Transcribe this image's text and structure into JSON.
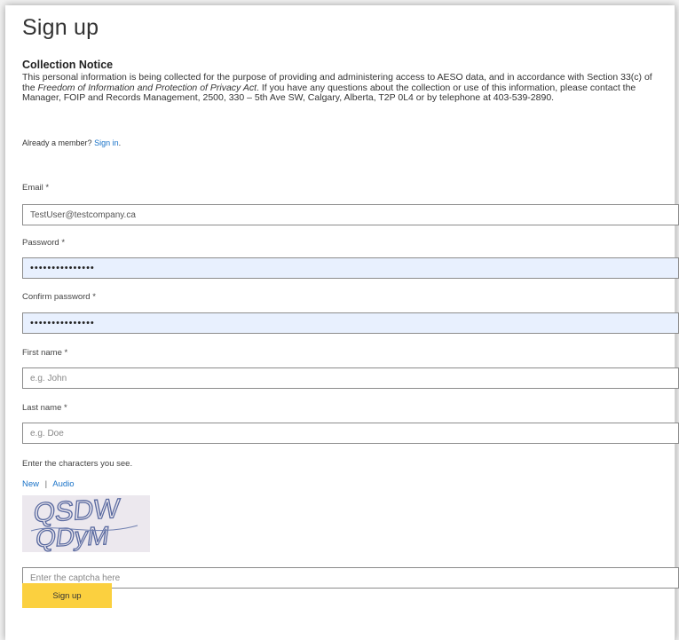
{
  "page": {
    "title": "Sign up"
  },
  "notice": {
    "title": "Collection Notice",
    "text_before_italic": "This personal information is being collected for the purpose of providing and administering access to AESO data, and in accordance with Section 33(c) of the ",
    "italic_text": "Freedom of Information and Protection of Privacy Act",
    "text_after_italic": ". If you have any questions about the collection or use of this information, please contact the Manager, FOIP and Records Management, 2500, 330 – 5th Ave SW, Calgary, Alberta, T2P 0L4 or by telephone at 403-539-2890."
  },
  "member": {
    "prompt": "Already a member?",
    "signin_label": "Sign in",
    "suffix": "."
  },
  "form": {
    "email": {
      "label": "Email *",
      "value": "TestUser@testcompany.ca"
    },
    "password": {
      "label": "Password *",
      "value": "•••••••••••••••"
    },
    "confirm_password": {
      "label": "Confirm password *",
      "value": "•••••••••••••••"
    },
    "first_name": {
      "label": "First name *",
      "placeholder": "e.g. John"
    },
    "last_name": {
      "label": "Last name *",
      "placeholder": "e.g. Doe"
    }
  },
  "captcha": {
    "instruction": "Enter the characters you see.",
    "new_label": "New",
    "separator": "|",
    "audio_label": "Audio",
    "image_text_line1": "QSDW",
    "image_text_line2": "QDyM",
    "input_placeholder": "Enter the captcha here"
  },
  "submit": {
    "label": "Sign up",
    "color": "#fbd03f"
  },
  "colors": {
    "link": "#1a73c8",
    "autofill_bg": "#e8f0fe"
  }
}
